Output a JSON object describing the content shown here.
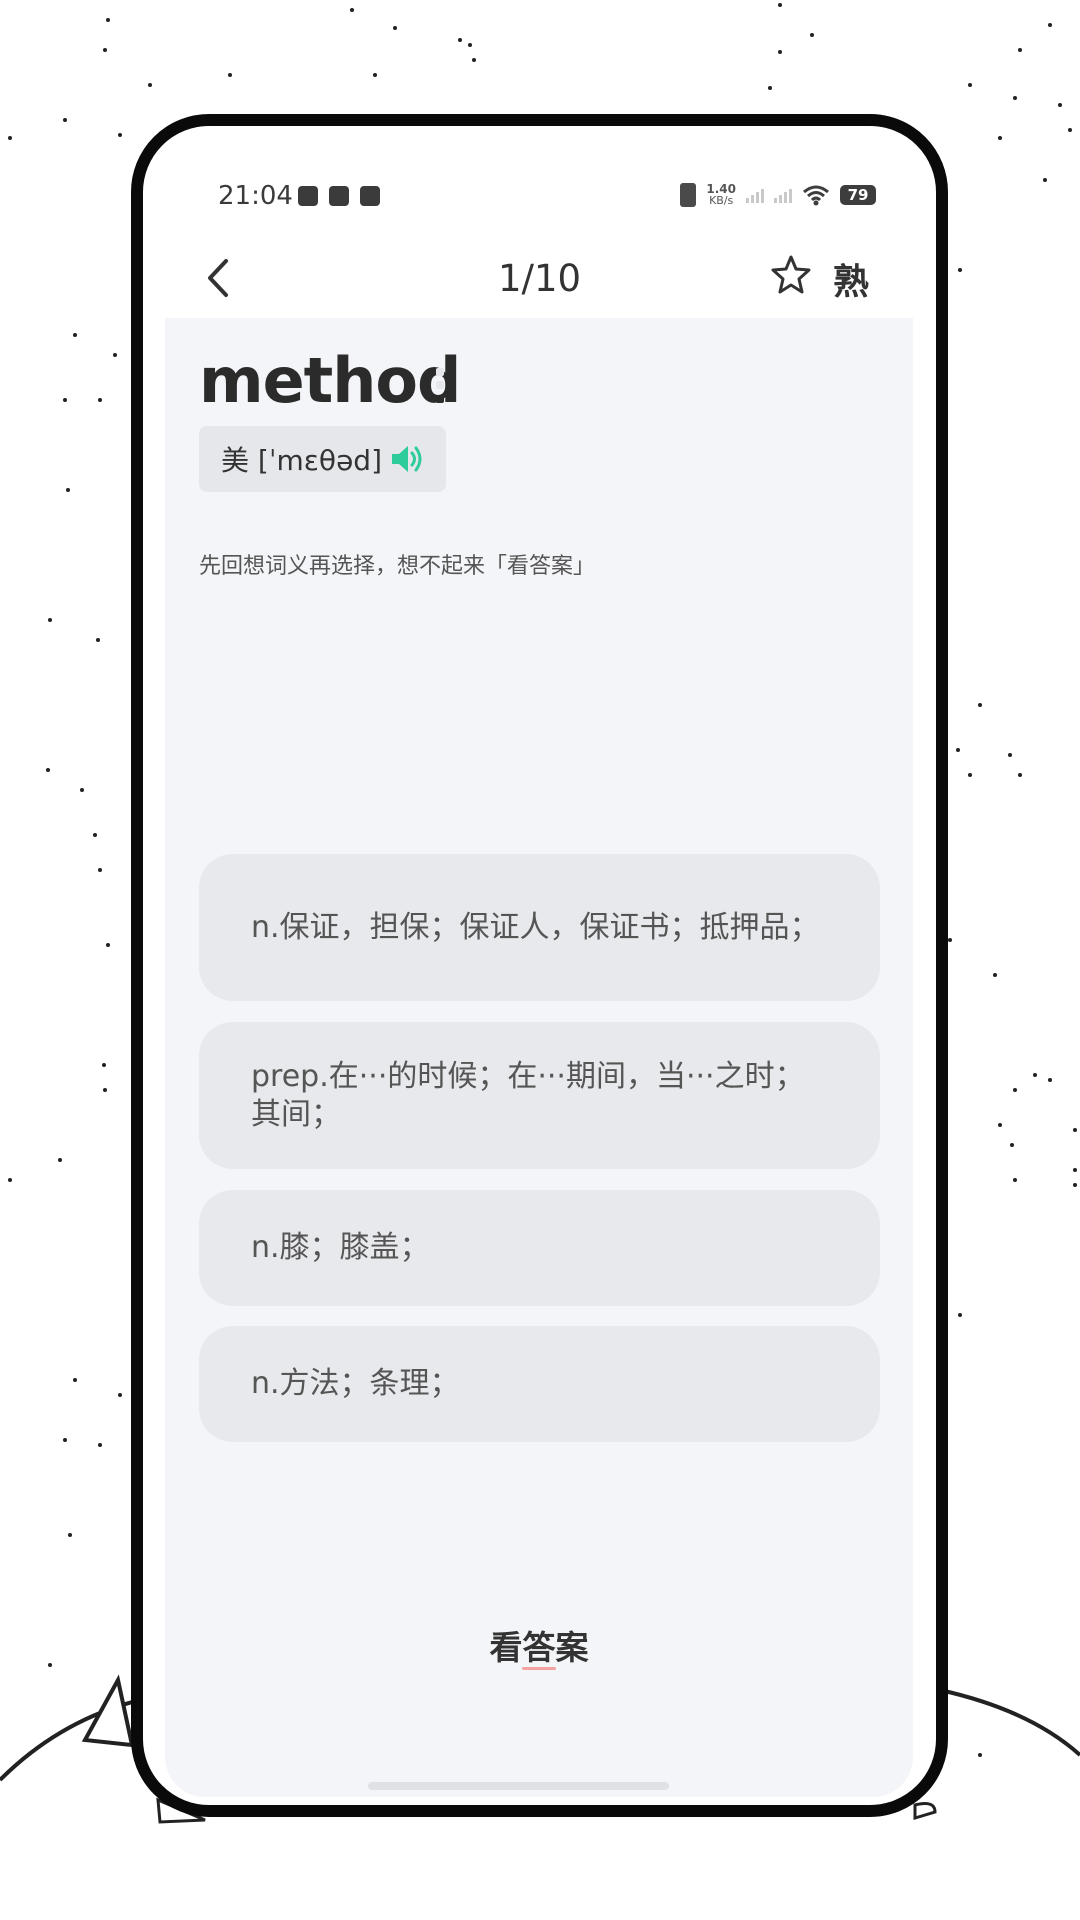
{
  "status_bar": {
    "time": "21:04",
    "net_speed_value": "1.40",
    "net_speed_unit": "KB/s",
    "battery": "79"
  },
  "nav": {
    "counter": "1/10",
    "familiar_label": "熟"
  },
  "word": {
    "text": "method",
    "phonetic_label": "美 [ˈmɛθəd]"
  },
  "hint": "先回想词义再选择，想不起来「看答案」",
  "options": [
    {
      "label": "n.保证，担保；保证人，保证书；抵押品；"
    },
    {
      "label": "prep.在···的时候；在···期间，当···之时；其间；"
    },
    {
      "label": "n.膝；膝盖；"
    },
    {
      "label": "n.方法；条理；"
    }
  ],
  "answer_button": "看答案",
  "colors": {
    "accent": "#2ecc9a",
    "card_bg": "#f4f5f8",
    "option_bg": "#e8e9ec",
    "underline": "#f4a3a3"
  },
  "icons": [
    "back-arrow-icon",
    "star-outline-icon",
    "speaker-icon"
  ]
}
